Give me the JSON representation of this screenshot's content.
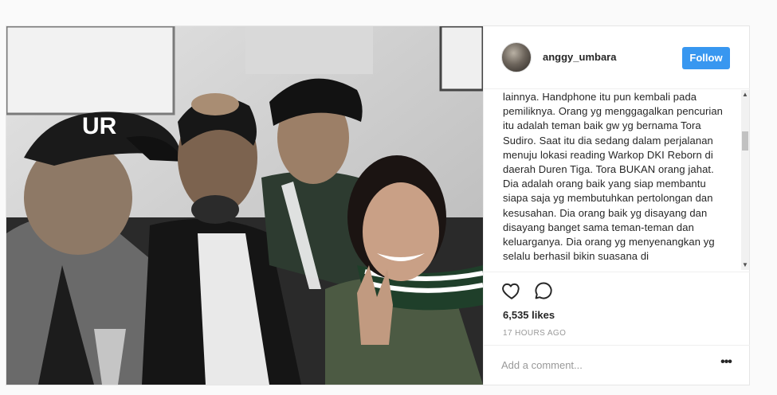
{
  "post": {
    "username": "anggy_umbara",
    "follow_label": "Follow",
    "caption": "lainnya. Handphone itu pun kembali pada pemiliknya. Orang yg menggagalkan pencurian itu adalah teman baik gw yg bernama Tora Sudiro. Saat itu dia sedang dalam perjalanan menuju lokasi reading Warkop DKI Reborn di daerah Duren Tiga. Tora BUKAN orang jahat. Dia adalah orang baik yang siap membantu siapa saja yg membutuhkan pertolongan dan kesusahan. Dia orang baik yg disayang dan disayang banget sama teman-teman dan keluarganya. Dia orang yg menyenangkan yg selalu berhasil bikin suasana di",
    "likes": "6,535 likes",
    "time_ago": "17 HOURS AGO",
    "comment_placeholder": "Add a comment...",
    "more_label": "•••",
    "photo_cap_text": "UR"
  },
  "icons": {
    "like": "heart-outline-icon",
    "comment": "speech-bubble-icon",
    "more": "ellipsis-icon",
    "scroll_up": "triangle-up-icon",
    "scroll_down": "triangle-down-icon"
  },
  "colors": {
    "follow_button": "#3897f0",
    "text": "#262626",
    "muted": "#999999",
    "border": "#efefef"
  }
}
